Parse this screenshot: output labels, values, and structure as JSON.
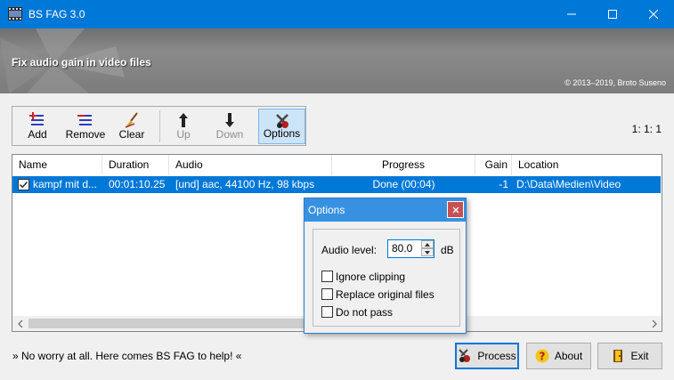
{
  "window": {
    "title": "BS FAG 3.0",
    "icons": {
      "minimize": "minimize-icon",
      "maximize": "maximize-icon",
      "close": "close-icon"
    }
  },
  "banner": {
    "heading": "Fix audio gain in video files",
    "copyright": "© 2013–2019, Broto Suseno"
  },
  "toolbar": {
    "add": "Add",
    "remove": "Remove",
    "clear": "Clear",
    "up": "Up",
    "down": "Down",
    "options": "Options",
    "counter": "1: 1: 1"
  },
  "list": {
    "columns": [
      "Name",
      "Duration",
      "Audio",
      "Progress",
      "Gain",
      "Location"
    ],
    "rows": [
      {
        "checked": true,
        "name": "kampf mit d...",
        "duration": "00:01:10.25",
        "audio": "[und] aac, 44100 Hz, 98 kbps",
        "progress": "Done (00:04)",
        "gain": "-1",
        "location": "D:\\Data\\Medien\\Video"
      }
    ]
  },
  "status": "» No worry at all. Here comes BS FAG to help! «",
  "buttons": {
    "process": "Process",
    "about": "About",
    "exit": "Exit"
  },
  "options_dialog": {
    "title": "Options",
    "audio_level_label": "Audio level:",
    "audio_level_value": "80.0",
    "audio_level_unit": "dB",
    "ignore_clipping": "Ignore clipping",
    "replace_original": "Replace original files",
    "do_not_pass": "Do not pass",
    "ignore_clipping_checked": false,
    "replace_original_checked": false,
    "do_not_pass_checked": false
  },
  "colors": {
    "titlebar": "#0078d7",
    "selection": "#0078d7",
    "dialog_title": "#3891e0"
  }
}
